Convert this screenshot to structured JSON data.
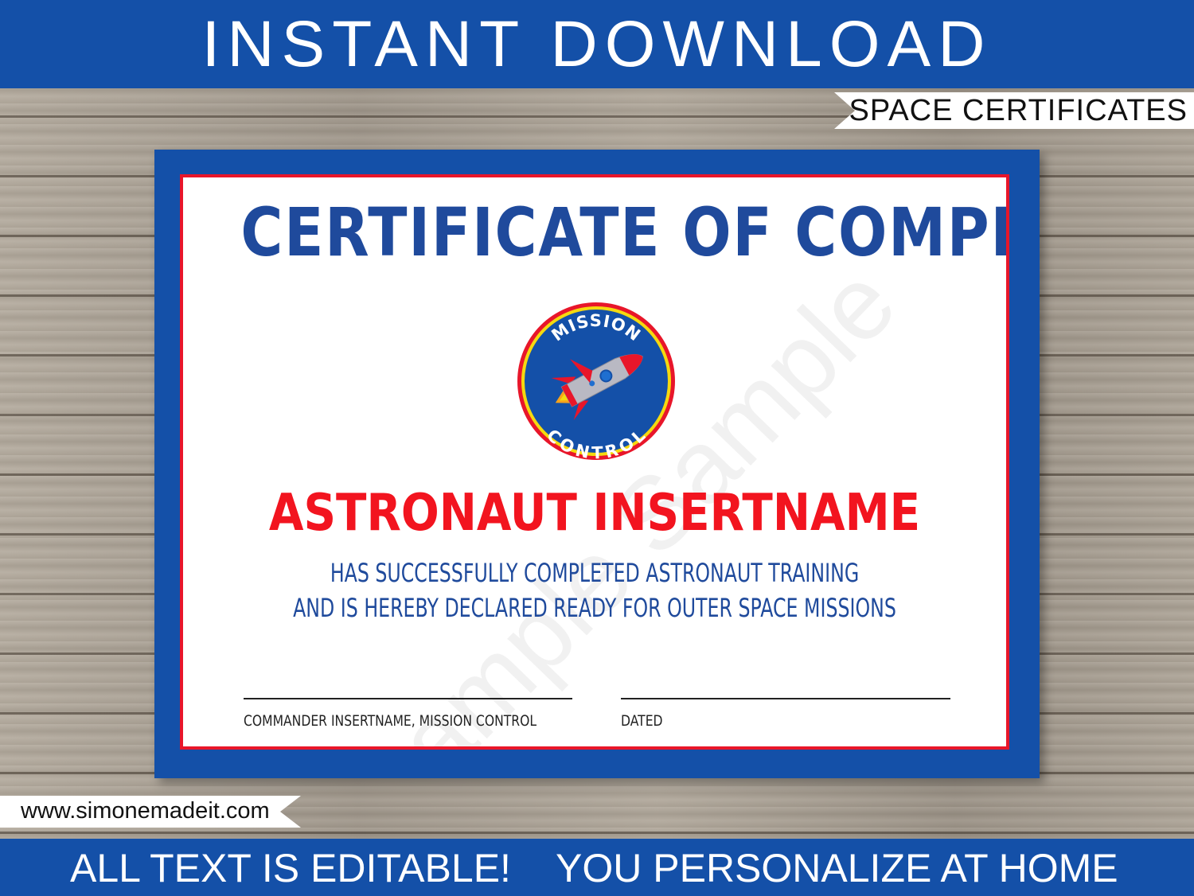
{
  "header": {
    "title": "INSTANT DOWNLOAD",
    "category_ribbon": "SPACE CERTIFICATES"
  },
  "certificate": {
    "title": "CERTIFICATE OF COMPLETION",
    "badge": {
      "top_text": "MISSION",
      "bottom_text": "CONTROL",
      "icon": "rocket-icon"
    },
    "recipient_name": "ASTRONAUT INSERTNAME",
    "statement_line1": "HAS SUCCESSFULLY COMPLETED ASTRONAUT TRAINING",
    "statement_line2": "AND IS HEREBY DECLARED READY FOR OUTER SPACE MISSIONS",
    "signature_label": "COMMANDER INSERTNAME, MISSION CONTROL",
    "date_label": "DATED",
    "watermark": "Sample Sample"
  },
  "footer": {
    "website": "www.simonemadeit.com",
    "left_text": "ALL TEXT IS EDITABLE!",
    "right_text": "YOU PERSONALIZE AT HOME"
  },
  "colors": {
    "brand_blue": "#1450a8",
    "title_blue": "#1f4a9c",
    "accent_red": "#f2141f",
    "badge_yellow": "#f5d90f"
  }
}
